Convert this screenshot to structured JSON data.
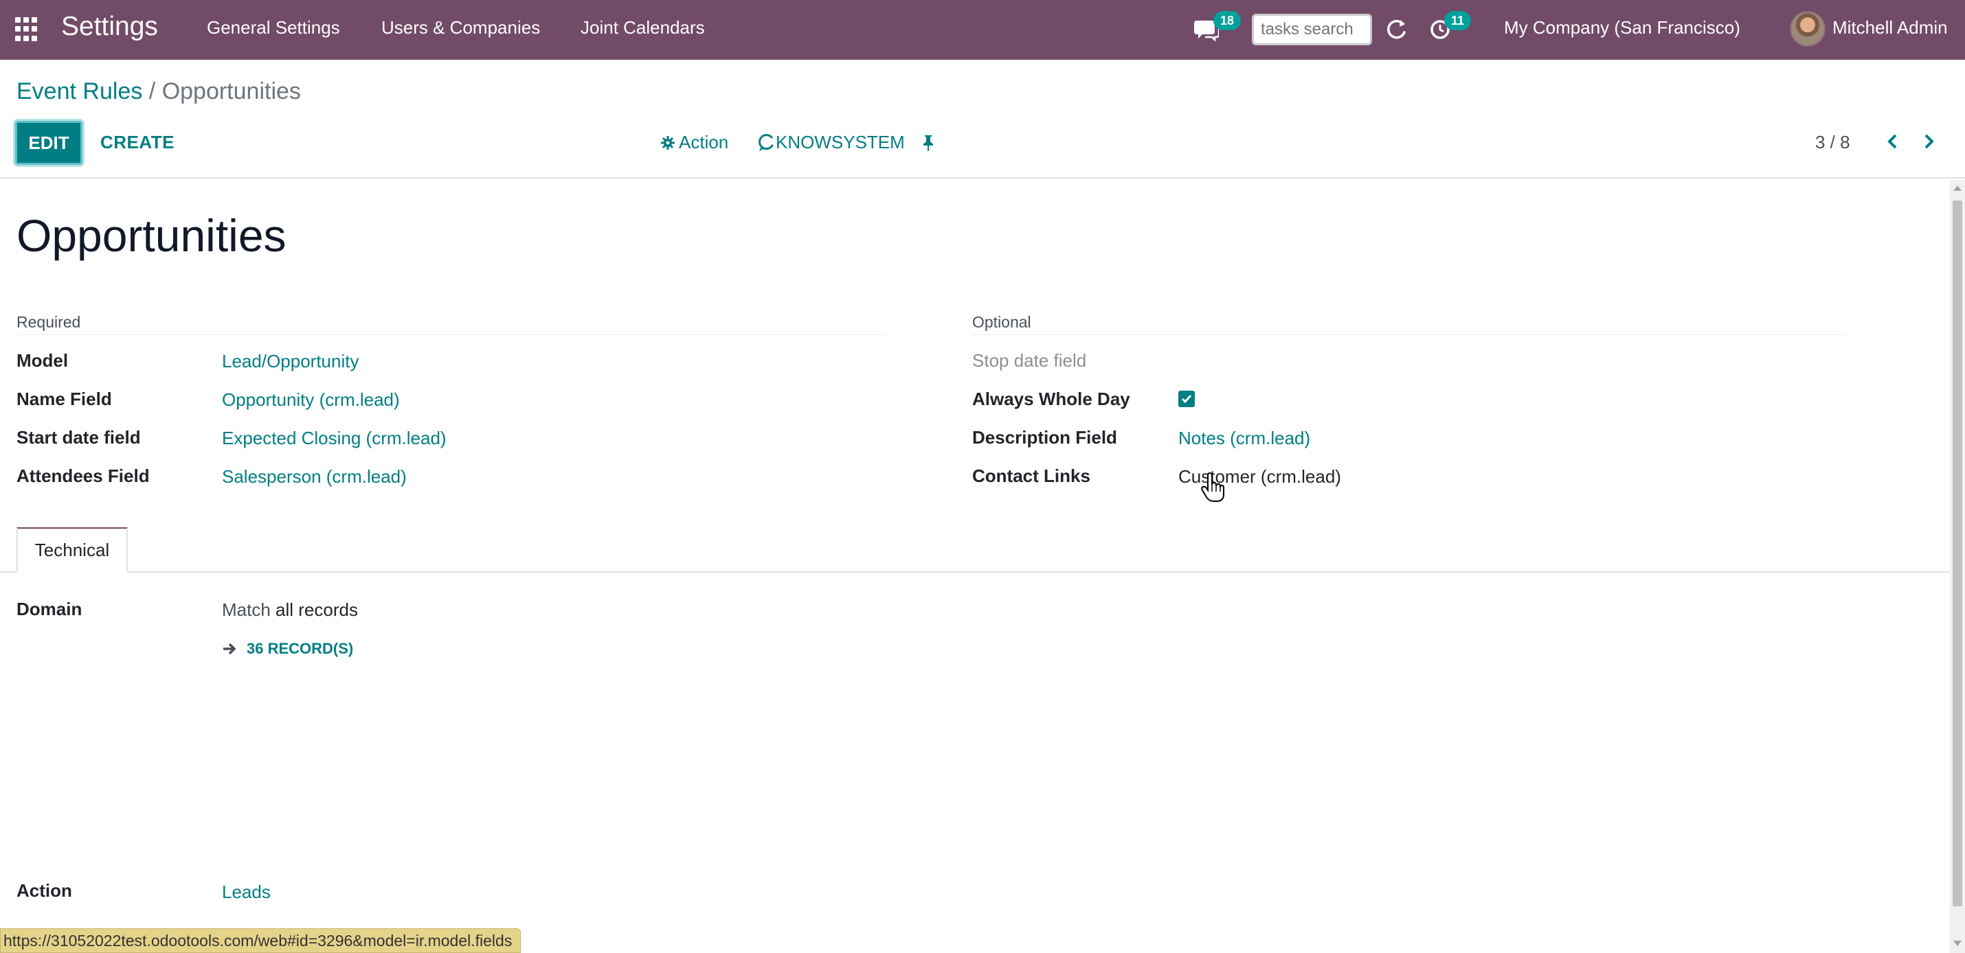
{
  "navbar": {
    "app_name": "Settings",
    "menus": [
      "General Settings",
      "Users & Companies",
      "Joint Calendars"
    ],
    "messages_badge": "18",
    "search_placeholder": "tasks search",
    "activities_badge": "11",
    "company": "My Company (San Francisco)",
    "user": "Mitchell Admin",
    "bg_color": "#714b67"
  },
  "breadcrumb": {
    "parent": "Event Rules",
    "separator": "/",
    "current": "Opportunities"
  },
  "control_panel": {
    "edit_label": "EDIT",
    "create_label": "CREATE",
    "action_label": "Action",
    "knowsystem_label": "KNOWSYSTEM",
    "pager": "3 / 8"
  },
  "form": {
    "title": "Opportunities",
    "required_group": {
      "title": "Required",
      "fields": [
        {
          "label": "Model",
          "value": "Lead/Opportunity"
        },
        {
          "label": "Name Field",
          "value": "Opportunity (crm.lead)"
        },
        {
          "label": "Start date field",
          "value": "Expected Closing (crm.lead)"
        },
        {
          "label": "Attendees Field",
          "value": "Salesperson (crm.lead)"
        }
      ]
    },
    "optional_group": {
      "title": "Optional",
      "stop_date_placeholder": "Stop date field",
      "always_whole_day_label": "Always Whole Day",
      "always_whole_day_checked": true,
      "description_label": "Description Field",
      "description_value": "Notes (crm.lead)",
      "contact_links_label": "Contact Links",
      "contact_links_value": "Customer (crm.lead)"
    },
    "tabs": [
      "Technical"
    ],
    "domain": {
      "label": "Domain",
      "match_prefix": "Match ",
      "match_value": "all records",
      "records": "36 RECORD(S)"
    },
    "action": {
      "label": "Action",
      "value": "Leads"
    }
  },
  "status_url": "https://31052022test.odootools.com/web#id=3296&model=ir.model.fields",
  "accent_color": "#017e84"
}
